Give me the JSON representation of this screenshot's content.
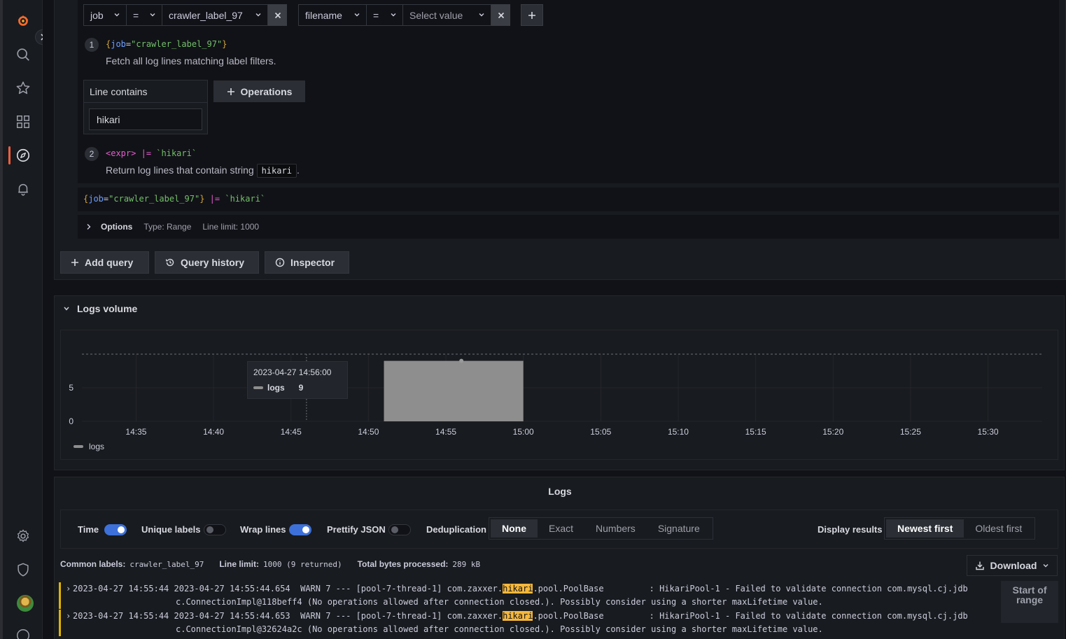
{
  "query": {
    "filters": [
      {
        "label": "job",
        "operator": "=",
        "value": "crawler_label_97"
      },
      {
        "label": "filename",
        "operator": "=",
        "value_placeholder": "Select value"
      }
    ],
    "steps": [
      {
        "num": "1",
        "code_brace_open": "{",
        "code_label": "job",
        "code_eq": "=",
        "code_value": "\"crawler_label_97\"",
        "code_brace_close": "}",
        "description": "Fetch all log lines matching label filters."
      },
      {
        "num": "2",
        "code_expr": "<expr>",
        "code_pipe": "|=",
        "code_str": "`hikari`",
        "description_prefix": "Return log lines that contain string",
        "description_chip": "hikari",
        "description_suffix": "."
      }
    ],
    "line_contains": {
      "title": "Line contains",
      "value": "hikari"
    },
    "operations_label": "Operations",
    "raw": {
      "brace_open": "{",
      "label": "job",
      "eq": "=",
      "value": "\"crawler_label_97\"",
      "brace_close": "}",
      "pipe": "|=",
      "str": "`hikari`"
    },
    "options": {
      "label": "Options",
      "type": "Type: Range",
      "line_limit": "Line limit: 1000"
    }
  },
  "actions": {
    "add_query": "Add query",
    "query_history": "Query history",
    "inspector": "Inspector"
  },
  "logs_volume": {
    "title": "Logs volume",
    "tooltip": {
      "time": "2023-04-27 14:56:00",
      "series": "logs",
      "value": "9"
    },
    "legend": "logs"
  },
  "chart_data": {
    "type": "bar",
    "title": "",
    "x": [
      "14:35",
      "14:40",
      "14:45",
      "14:50",
      "14:55",
      "15:00",
      "15:05",
      "15:10",
      "15:15",
      "15:20",
      "15:25",
      "15:30"
    ],
    "y_ticks": [
      "0",
      "5"
    ],
    "ylim": [
      0,
      10
    ],
    "series": [
      {
        "name": "logs",
        "color": "#8e8e8e",
        "bars": [
          {
            "from": "14:51",
            "to": "15:00",
            "value": 9
          }
        ]
      }
    ],
    "threshold_dashed": 10,
    "legend_position": "bottom-left",
    "grid": true
  },
  "logs": {
    "title": "Logs",
    "controls": {
      "time": {
        "label": "Time",
        "on": true
      },
      "unique_labels": {
        "label": "Unique labels",
        "on": false
      },
      "wrap_lines": {
        "label": "Wrap lines",
        "on": true
      },
      "prettify_json": {
        "label": "Prettify JSON",
        "on": false
      },
      "dedup_label": "Deduplication",
      "dedup_options": [
        "None",
        "Exact",
        "Numbers",
        "Signature"
      ],
      "dedup_selected": "None",
      "display_label": "Display results",
      "display_options": [
        "Newest first",
        "Oldest first"
      ],
      "display_selected": "Newest first"
    },
    "meta": {
      "common_labels_label": "Common labels:",
      "common_labels_value": "crawler_label_97",
      "line_limit_label": "Line limit:",
      "line_limit_value": "1000 (9 returned)",
      "bytes_label": "Total bytes processed:",
      "bytes_value": "289 kB"
    },
    "download_label": "Download",
    "start_of_range": "Start of range",
    "lines": [
      {
        "pre": "2023-04-27 14:55:44 2023-04-27 14:55:44.654  WARN 7 --- [pool-7-thread-1] com.zaxxer.",
        "hl": "hikari",
        "post": ".pool.PoolBase         : HikariPool-1 - Failed to validate connection com.mysql.cj.jdb",
        "cont": "c.ConnectionImpl@118beff4 (No operations allowed after connection closed.). Possibly consider using a shorter maxLifetime value."
      },
      {
        "pre": "2023-04-27 14:55:44 2023-04-27 14:55:44.653  WARN 7 --- [pool-7-thread-1] com.zaxxer.",
        "hl": "hikari",
        "post": ".pool.PoolBase         : HikariPool-1 - Failed to validate connection com.mysql.cj.jdb",
        "cont": "c.ConnectionImpl@32624a2c (No operations allowed after connection closed.). Possibly consider using a shorter maxLifetime value."
      }
    ]
  }
}
